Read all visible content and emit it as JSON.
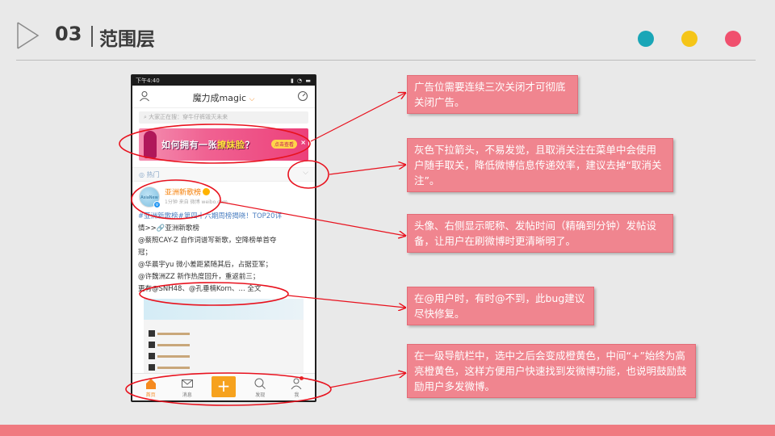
{
  "header": {
    "number": "03",
    "title": "范围层"
  },
  "dots": [
    "#1aa6b7",
    "#f5c518",
    "#f0506e"
  ],
  "phone": {
    "status_time": "下午4:40",
    "app_name": "魔力成magic",
    "search_placeholder": "大家正在搜：穿牛仔裤毁灭未来",
    "ad": {
      "text_before": "如何拥有一张",
      "text_highlight": "撩妹脸",
      "text_after": "？",
      "button": "点击查看",
      "close": "×"
    },
    "section_label": "热门",
    "post": {
      "nickname": "亚洲新歌榜",
      "meta": "1分钟  来自 微博 weibo.com",
      "lines": [
        "#亚洲新歌榜#第四十六期周榜揭晓！TOP20详",
        "情>>🔗亚洲新歌榜",
        "@蔡照CAY-Z 自作词谱写新歌，空降榜单首夺",
        "冠；",
        "@华晨宇yu 微小差距紧随其后，占据亚军；",
        "@许魏洲ZZ 新作热度回升，重返前三；",
        "更有@SNH48、@孔垂楠Korn、... 全文"
      ]
    },
    "tabs": [
      {
        "label": "首页",
        "icon": "home-icon"
      },
      {
        "label": "消息",
        "icon": "mail-icon"
      },
      {
        "label": "",
        "icon": "plus-icon"
      },
      {
        "label": "发现",
        "icon": "search-icon"
      },
      {
        "label": "我",
        "icon": "profile-icon"
      }
    ]
  },
  "notes": [
    "广告位需要连续三次关闭才可彻底关闭广告。",
    "灰色下拉箭头，不易发觉，且取消关注在菜单中会使用户随手取关，降低微博信息传递效率，建议去掉“取消关注”。",
    "头像、右侧显示昵称、发帖时间（精确到分钟）发帖设备，让用户在刷微博时更清晰明了。",
    "在@用户时，有时@不到，此bug建议尽快修复。",
    "在一级导航栏中，选中之后会变成橙黄色，中间“+”始终为高亮橙黄色，这样方便用户快速找到发微博功能，也说明鼓励鼓励用户多发微博。"
  ],
  "colors": {
    "note_bg": "#f0858f",
    "annotation_red": "#e8121e",
    "footer": "#f07a80",
    "accent_orange": "#f58a1f"
  }
}
